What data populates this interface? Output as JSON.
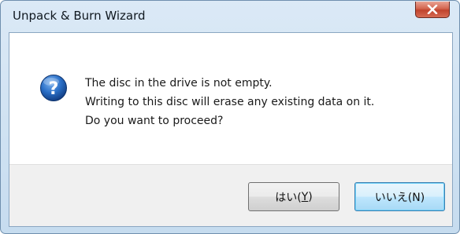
{
  "window": {
    "title": "Unpack & Burn Wizard",
    "close_label": "X"
  },
  "dialog": {
    "icon": "question-icon",
    "message_lines": [
      "The disc in the drive is not empty.",
      "Writing to this disc will erase any existing data on it.",
      "Do you want to proceed?"
    ]
  },
  "buttons": {
    "yes": {
      "prefix": "はい(",
      "mnemonic": "Y",
      "suffix": ")"
    },
    "no": {
      "label": "いいえ(N)"
    }
  },
  "colors": {
    "title_bar": "#c6dcef",
    "close_button": "#c0432d",
    "question_icon": "#1f63b8",
    "button_area": "#f0f0f0",
    "default_button_border": "#3c7fb1"
  }
}
